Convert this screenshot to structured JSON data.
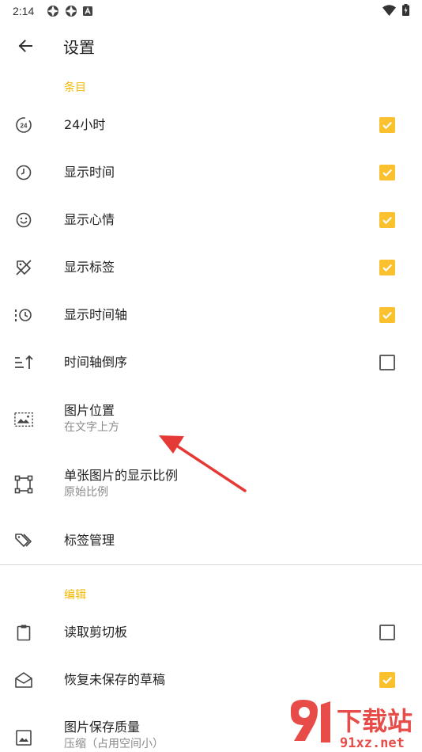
{
  "status_bar": {
    "time": "2:14"
  },
  "app_bar": {
    "title": "设置"
  },
  "sections": {
    "items_header": "条目",
    "edit_header": "编辑"
  },
  "rows": {
    "h24": {
      "title": "24小时",
      "checked": true
    },
    "show_time": {
      "title": "显示时间",
      "checked": true
    },
    "show_mood": {
      "title": "显示心情",
      "checked": true
    },
    "show_tags": {
      "title": "显示标签",
      "checked": true
    },
    "show_timeline": {
      "title": "显示时间轴",
      "checked": true
    },
    "timeline_reverse": {
      "title": "时间轴倒序",
      "checked": false
    },
    "image_position": {
      "title": "图片位置",
      "subtitle": "在文字上方"
    },
    "image_ratio": {
      "title": "单张图片的显示比例",
      "subtitle": "原始比例"
    },
    "tag_manage": {
      "title": "标签管理"
    },
    "read_clipboard": {
      "title": "读取剪切板",
      "checked": false
    },
    "restore_draft": {
      "title": "恢复未保存的草稿",
      "checked": true
    },
    "image_quality": {
      "title": "图片保存质量",
      "subtitle": "压缩（占用空间小）"
    }
  },
  "watermark": {
    "brand": "下载站",
    "site": "91xz.net"
  },
  "colors": {
    "accent": "#fbc02d",
    "section": "#f5b800",
    "arrow": "#e53935"
  }
}
